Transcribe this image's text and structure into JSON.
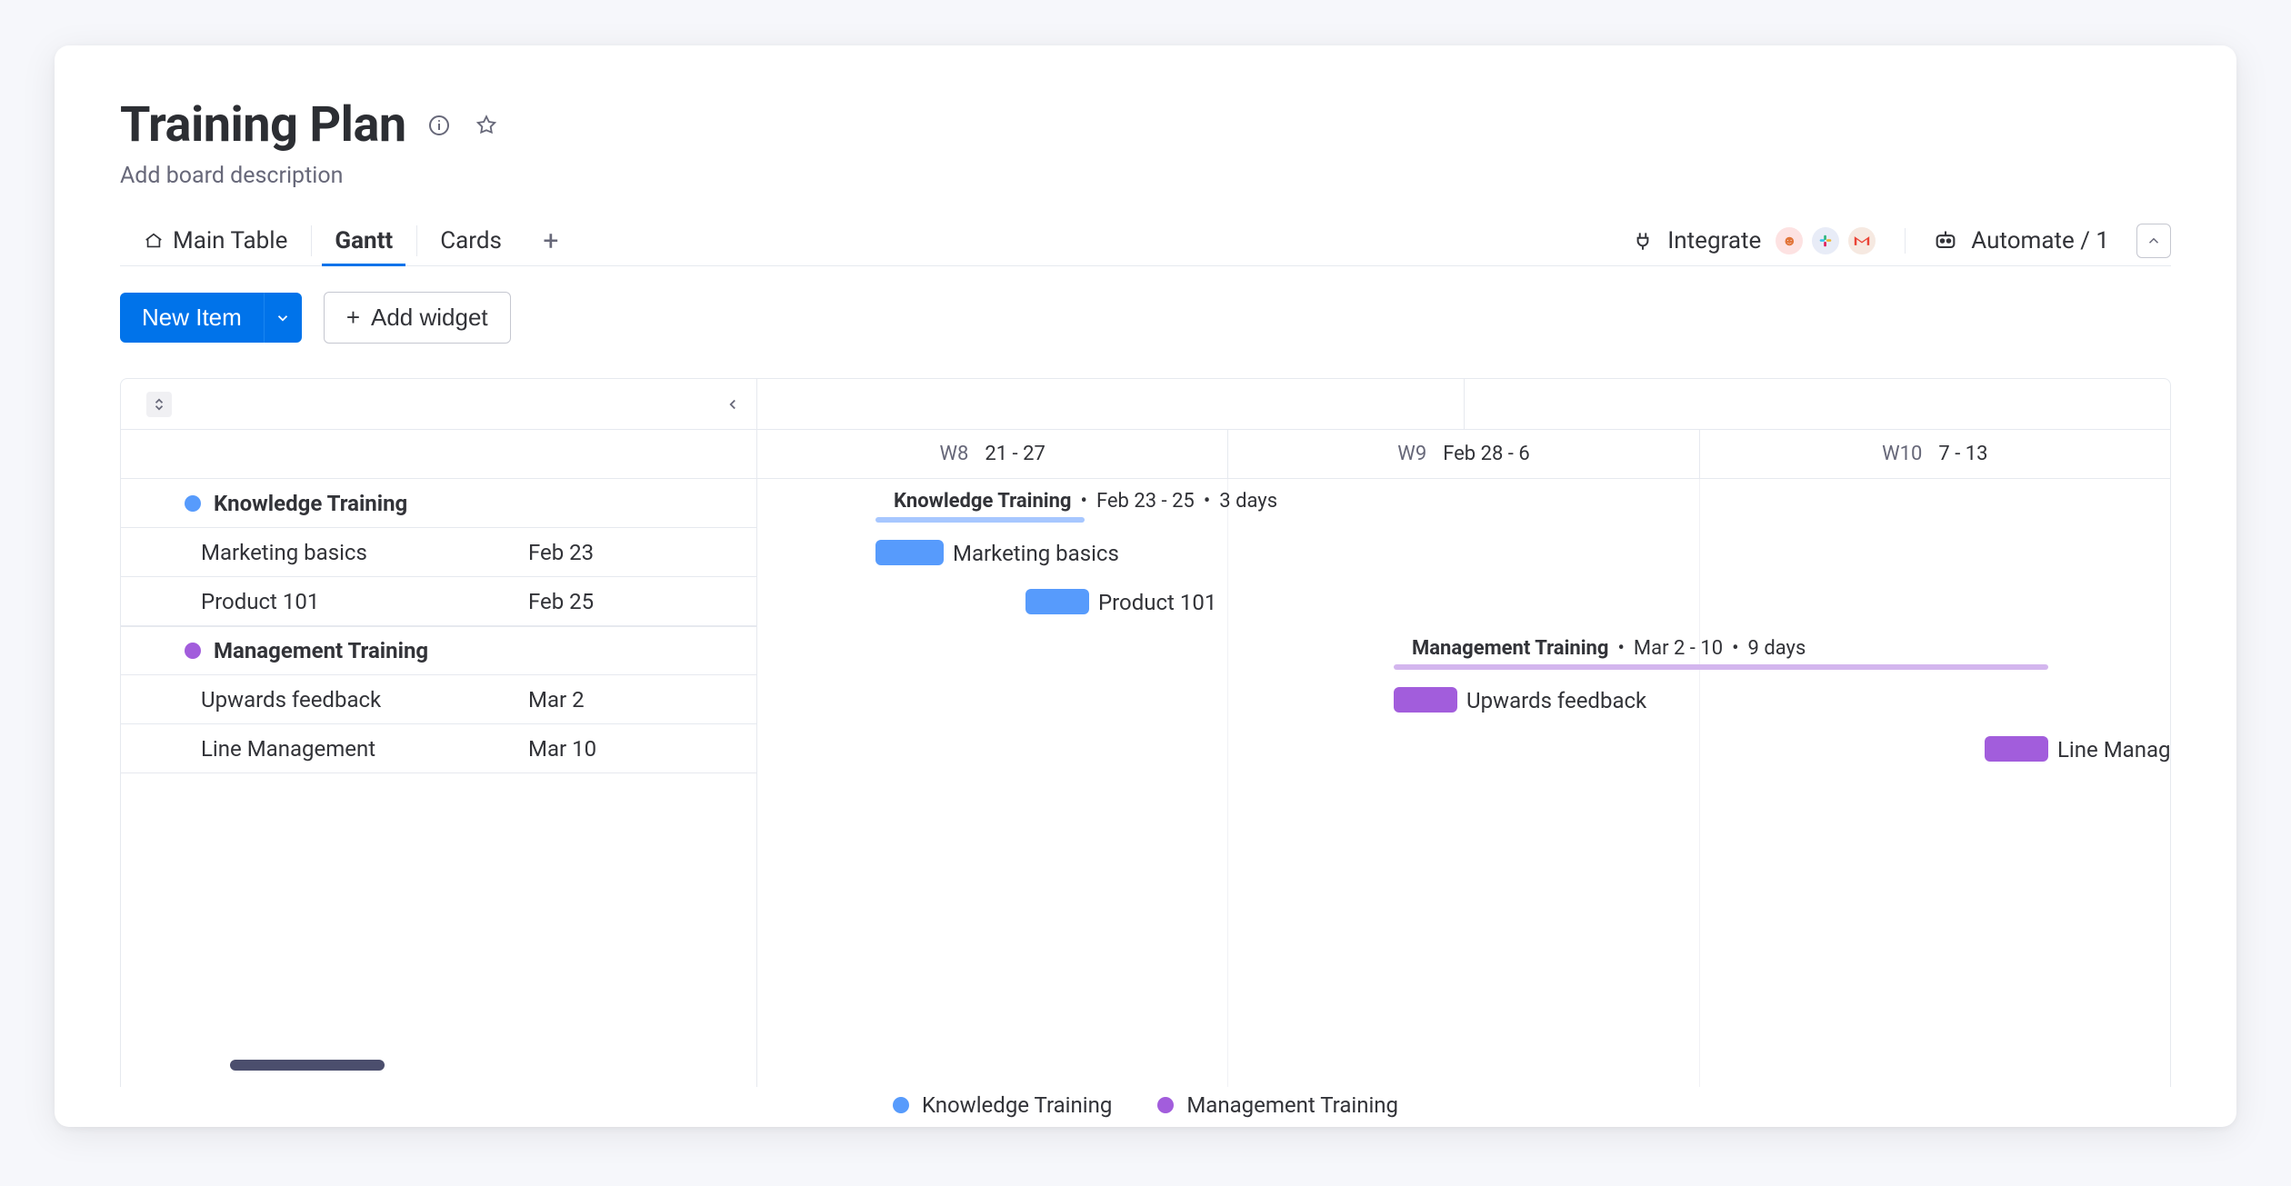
{
  "header": {
    "title": "Training Plan",
    "description": "Add board description"
  },
  "tabs": [
    {
      "label": "Main Table"
    },
    {
      "label": "Gantt"
    },
    {
      "label": "Cards"
    }
  ],
  "active_tab_index": 1,
  "buttons": {
    "integrate": "Integrate",
    "automate": "Automate / 1",
    "new_item": "New Item",
    "add_widget": "Add widget"
  },
  "weeks": [
    {
      "wk": "W8",
      "range": "21 - 27"
    },
    {
      "wk": "W9",
      "range": "Feb 28 - 6"
    },
    {
      "wk": "W10",
      "range": "7 - 13"
    }
  ],
  "colors": {
    "knowledge": "#579bfc",
    "knowledge_line": "#a7c7ff",
    "management": "#a25ddc",
    "management_line": "#d3b6ee"
  },
  "groups": [
    {
      "name": "Knowledge Training",
      "color_key": "knowledge",
      "range_label": "Feb 23 - 25",
      "duration_label": "3 days",
      "items": [
        {
          "name": "Marketing basics",
          "date": "Feb 23"
        },
        {
          "name": "Product 101",
          "date": "Feb 25"
        }
      ]
    },
    {
      "name": "Management Training",
      "color_key": "management",
      "range_label": "Mar 2 - 10",
      "duration_label": "9 days",
      "items": [
        {
          "name": "Upwards feedback",
          "date": "Mar 2"
        },
        {
          "name": "Line Management",
          "date": "Mar 10"
        }
      ]
    }
  ],
  "legend": [
    {
      "label": "Knowledge Training",
      "color_key": "knowledge"
    },
    {
      "label": "Management Training",
      "color_key": "management"
    }
  ]
}
